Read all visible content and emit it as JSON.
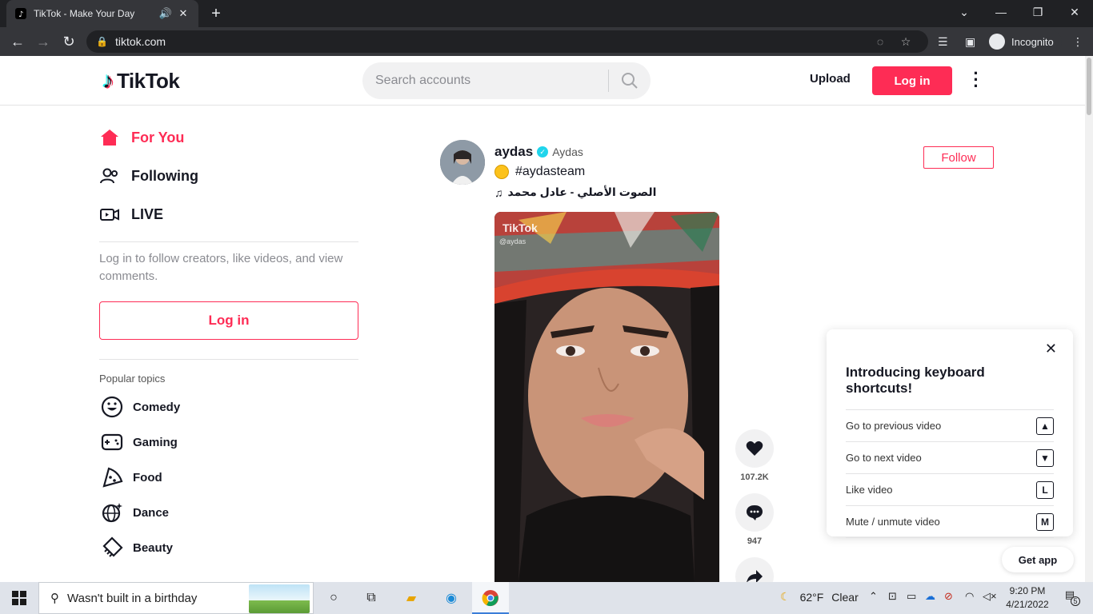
{
  "browser": {
    "tab_title": "TikTok - Make Your Day",
    "url": "tiktok.com",
    "profile_label": "Incognito"
  },
  "header": {
    "logo_text": "TikTok",
    "search_placeholder": "Search accounts",
    "upload_label": "Upload",
    "login_label": "Log in"
  },
  "sidebar": {
    "nav": [
      {
        "label": "For You",
        "icon": "home-icon"
      },
      {
        "label": "Following",
        "icon": "users-icon"
      },
      {
        "label": "LIVE",
        "icon": "live-icon"
      }
    ],
    "login_prompt": "Log in to follow creators, like videos, and view comments.",
    "login_button": "Log in",
    "popular_title": "Popular topics",
    "topics": [
      {
        "label": "Comedy",
        "icon": "smile-icon"
      },
      {
        "label": "Gaming",
        "icon": "gamepad-icon"
      },
      {
        "label": "Food",
        "icon": "pizza-icon"
      },
      {
        "label": "Dance",
        "icon": "discoball-icon"
      },
      {
        "label": "Beauty",
        "icon": "comb-icon"
      }
    ]
  },
  "post": {
    "username": "aydas",
    "nickname": "Aydas",
    "caption": "#aydasteam",
    "music": "الصوت الأصلي - عادل محمد",
    "follow_label": "Follow",
    "watermark": "TikTok",
    "watermark_handle": "@aydas",
    "likes": "107.2K",
    "comments": "947"
  },
  "shortcuts": {
    "title": "Introducing keyboard shortcuts!",
    "rows": [
      {
        "label": "Go to previous video",
        "key": "▲"
      },
      {
        "label": "Go to next video",
        "key": "▼"
      },
      {
        "label": "Like video",
        "key": "L"
      },
      {
        "label": "Mute / unmute video",
        "key": "M"
      }
    ]
  },
  "get_app": "Get app",
  "taskbar": {
    "search_text": "Wasn't built in a birthday",
    "temperature": "62°F",
    "weather": "Clear",
    "time": "9:20 PM",
    "date": "4/21/2022",
    "notif_count": "5"
  },
  "colors": {
    "brand": "#fe2c55",
    "text": "#161823"
  }
}
